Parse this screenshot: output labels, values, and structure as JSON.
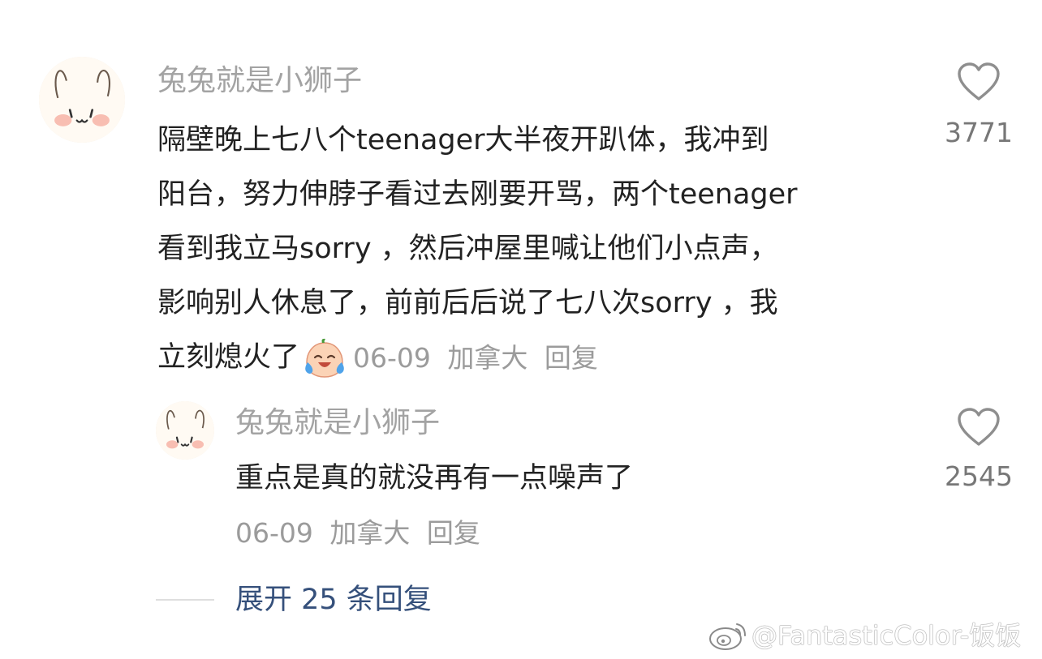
{
  "comment": {
    "username": "兔兔就是小狮子",
    "lines": [
      "隔壁晚上七八个teenager大半夜开趴体，我冲到",
      "阳台，努力伸脖子看过去刚要开骂，两个teenager",
      "看到我立马sorry ，然后冲屋里喊让他们小点声，",
      "影响别人休息了，前前后后说了七八次sorry ，我",
      "立刻熄火了"
    ],
    "emoji": "laughing-crying-face",
    "date": "06-09",
    "location": "加拿大",
    "reply_label": "回复",
    "like_count": "3771"
  },
  "reply": {
    "username": "兔兔就是小狮子",
    "text": "重点是真的就没再有一点噪声了",
    "date": "06-09",
    "location": "加拿大",
    "reply_label": "回复",
    "like_count": "2545"
  },
  "expand_replies": "展开 25 条回复",
  "watermark": "@FantasticColor-饭饭",
  "colors": {
    "username": "#a3a3a3",
    "body_text": "#222222",
    "meta": "#9b9b9b",
    "link": "#35507b"
  }
}
